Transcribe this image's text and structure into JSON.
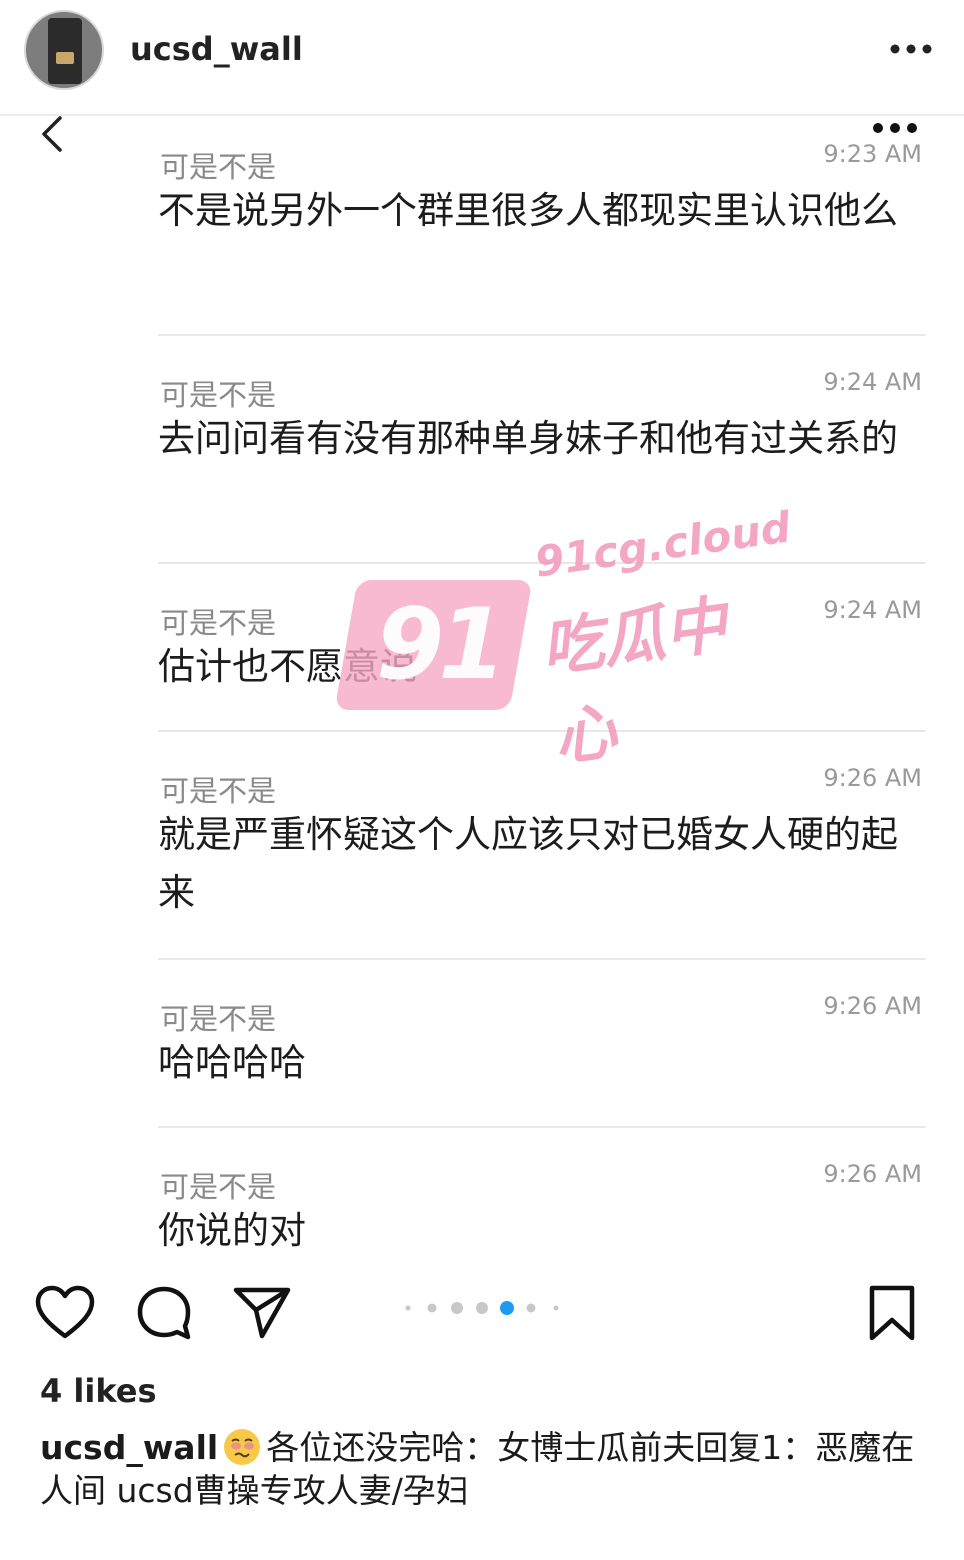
{
  "header": {
    "username": "ucsd_wall",
    "more_icon": "more-horizontal-icon"
  },
  "chat": {
    "back_icon": "chevron-left-icon",
    "more_icon": "more-horizontal-icon",
    "messages": [
      {
        "sender": "可是不是",
        "time": "9:23 AM",
        "text": "不是说另外一个群里很多人都现实里认识他么"
      },
      {
        "sender": "可是不是",
        "time": "9:24 AM",
        "text": "去问问看有没有那种单身妹子和他有过关系的"
      },
      {
        "sender": "可是不是",
        "time": "9:24 AM",
        "text": "估计也不愿意说"
      },
      {
        "sender": "可是不是",
        "time": "9:26 AM",
        "text": "就是严重怀疑这个人应该只对已婚女人硬的起来"
      },
      {
        "sender": "可是不是",
        "time": "9:26 AM",
        "text": "哈哈哈哈"
      },
      {
        "sender": "可是不是",
        "time": "9:26 AM",
        "text": "你说的对"
      }
    ]
  },
  "watermark": {
    "number": "91",
    "domain": "91cg.cloud",
    "name": "吃瓜中心"
  },
  "actions": {
    "like_icon": "heart-icon",
    "comment_icon": "comment-icon",
    "share_icon": "send-icon",
    "save_icon": "bookmark-icon",
    "carousel": {
      "total": 7,
      "active": 4
    }
  },
  "post": {
    "likes": "4 likes",
    "caption_user": "ucsd_wall",
    "caption_emoji": "woozy-face-icon",
    "caption_text": "各位还没完哈：女博士瓜前夫回复1：恶魔在人间 ucsd曹操专攻人妻/孕妇"
  },
  "colors": {
    "carousel_active": "#1d9bf0",
    "carousel_inactive": "#c8c8c8",
    "watermark_pink": "#f398ba"
  }
}
